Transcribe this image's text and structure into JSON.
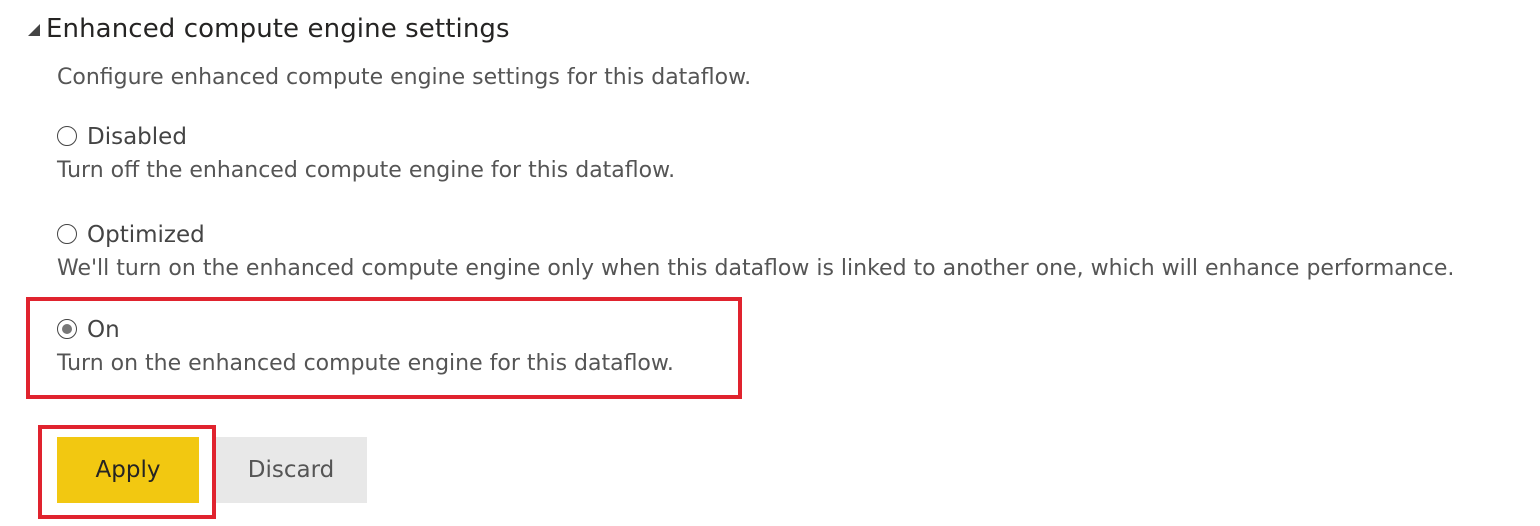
{
  "section": {
    "title": "Enhanced compute engine settings",
    "description": "Configure enhanced compute engine settings for this dataflow."
  },
  "options": [
    {
      "label": "Disabled",
      "description": "Turn off the enhanced compute engine for this dataflow.",
      "selected": false
    },
    {
      "label": "Optimized",
      "description": "We'll turn on the enhanced compute engine only when this dataflow is linked to another one, which will enhance performance.",
      "selected": false
    },
    {
      "label": "On",
      "description": "Turn on the enhanced compute engine for this dataflow.",
      "selected": true
    }
  ],
  "buttons": {
    "apply_label": "Apply",
    "discard_label": "Discard"
  },
  "colors": {
    "apply_bg": "#f2c811",
    "discard_bg": "#e8e8e8",
    "highlight": "#e0232e"
  }
}
